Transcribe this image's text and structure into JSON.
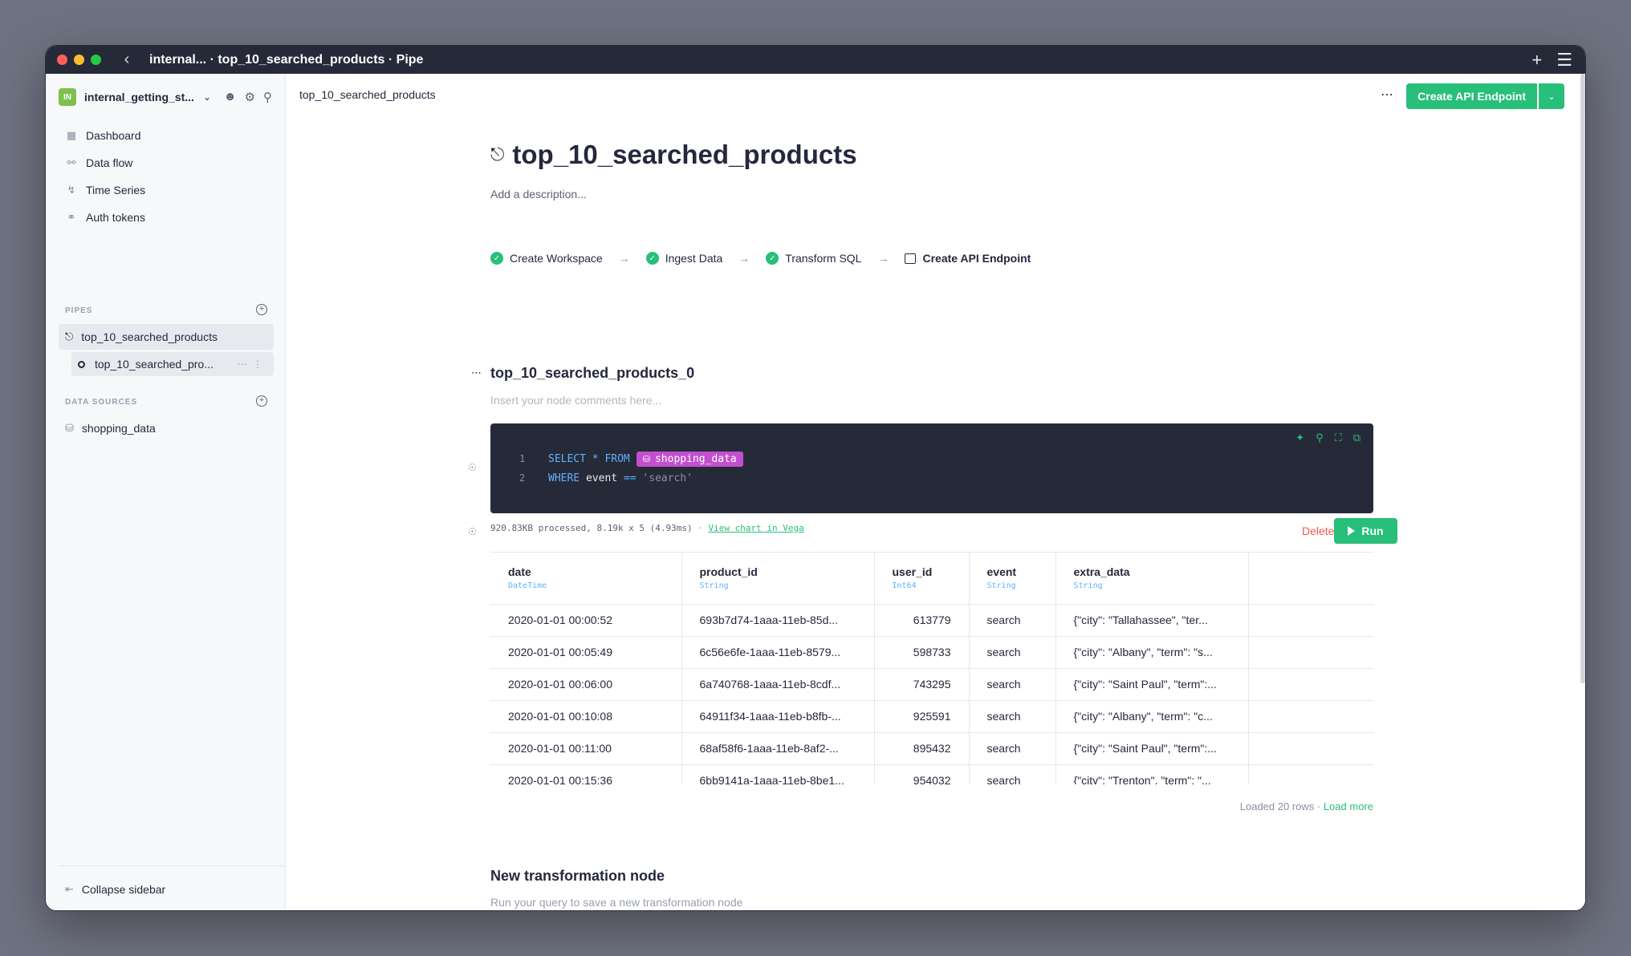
{
  "window": {
    "title": "internal... · top_10_searched_products · Pipe"
  },
  "sidebar": {
    "workspace_badge": "IN",
    "workspace_name": "internal_getting_st...",
    "nav": [
      {
        "label": "Dashboard",
        "icon": "grid-icon"
      },
      {
        "label": "Data flow",
        "icon": "flow-icon"
      },
      {
        "label": "Time Series",
        "icon": "chart-icon"
      },
      {
        "label": "Auth tokens",
        "icon": "key-icon"
      }
    ],
    "pipes_label": "PIPES",
    "pipe_name": "top_10_searched_products",
    "pipe_node": "top_10_searched_pro...",
    "datasources_label": "DATA SOURCES",
    "datasource": "shopping_data",
    "collapse_label": "Collapse sidebar"
  },
  "header": {
    "breadcrumb": "top_10_searched_products",
    "create_endpoint": "Create API Endpoint"
  },
  "page": {
    "title": "top_10_searched_products",
    "description_placeholder": "Add a description...",
    "steps": [
      "Create Workspace",
      "Ingest Data",
      "Transform SQL",
      "Create API Endpoint"
    ]
  },
  "node": {
    "name": "top_10_searched_products_0",
    "comment_placeholder": "Insert your node comments here...",
    "sql": {
      "line1_kw1": "SELECT",
      "line1_star": "*",
      "line1_kw2": "FROM",
      "line1_ds": "shopping_data",
      "line2_kw": "WHERE",
      "line2_ident": "event",
      "line2_op": "==",
      "line2_str": "'search'"
    },
    "stats": "920.83KB processed, 8.19k x 5 (4.93ms)",
    "view_chart": "View chart in Vega",
    "delete_label": "Delete",
    "run_label": "Run"
  },
  "table": {
    "columns": [
      {
        "name": "date",
        "type": "DateTime"
      },
      {
        "name": "product_id",
        "type": "String"
      },
      {
        "name": "user_id",
        "type": "Int64"
      },
      {
        "name": "event",
        "type": "String"
      },
      {
        "name": "extra_data",
        "type": "String"
      }
    ],
    "rows": [
      [
        "2020-01-01 00:00:52",
        "693b7d74-1aaa-11eb-85d...",
        "613779",
        "search",
        "{\"city\": \"Tallahassee\", \"ter..."
      ],
      [
        "2020-01-01 00:05:49",
        "6c56e6fe-1aaa-11eb-8579...",
        "598733",
        "search",
        "{\"city\": \"Albany\", \"term\": \"s..."
      ],
      [
        "2020-01-01 00:06:00",
        "6a740768-1aaa-11eb-8cdf...",
        "743295",
        "search",
        "{\"city\": \"Saint Paul\", \"term\":..."
      ],
      [
        "2020-01-01 00:10:08",
        "64911f34-1aaa-11eb-b8fb-...",
        "925591",
        "search",
        "{\"city\": \"Albany\", \"term\": \"c..."
      ],
      [
        "2020-01-01 00:11:00",
        "68af58f6-1aaa-11eb-8af2-...",
        "895432",
        "search",
        "{\"city\": \"Saint Paul\", \"term\":..."
      ],
      [
        "2020-01-01 00:15:36",
        "6bb9141a-1aaa-11eb-8be1...",
        "954032",
        "search",
        "{\"city\": \"Trenton\", \"term\": \"..."
      ]
    ],
    "loaded_text": "Loaded 20 rows",
    "load_more": "Load more"
  },
  "new_node": {
    "title": "New transformation node",
    "hint": "Run your query to save a new transformation node"
  },
  "colors": {
    "accent": "#27bf7a",
    "editor_bg": "#262a38",
    "datasource_chip": "#c24fce",
    "danger": "#ea5a4f"
  }
}
